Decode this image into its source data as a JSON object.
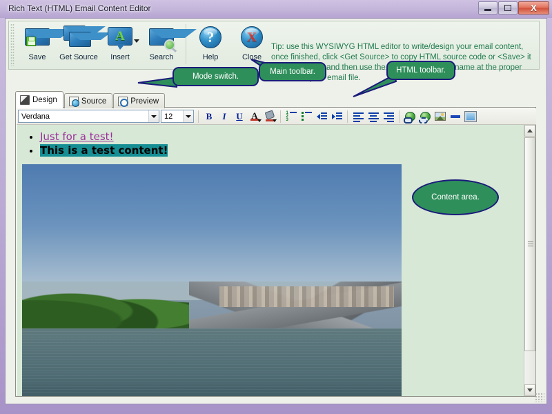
{
  "window": {
    "title": "Rich Text (HTML) Email Content Editor",
    "minimize_label": "Minimize",
    "maximize_label": "Maximize",
    "close_label": "X"
  },
  "main_toolbar": {
    "buttons": [
      {
        "label": "Save",
        "icon": "envelope-floppy-icon"
      },
      {
        "label": "Get Source",
        "icon": "two-envelopes-icon"
      },
      {
        "label": "Insert",
        "icon": "insert-text-bubble-icon",
        "has_dropdown": true
      },
      {
        "label": "Search",
        "icon": "envelope-magnifier-icon"
      },
      {
        "label": "Help",
        "icon": "blue-question-orb-icon"
      },
      {
        "label": "Close",
        "icon": "blue-red-x-orb-icon"
      }
    ],
    "tip": "Tip: use this WYSIWYG HTML editor to write/design your email content, once finished, click <Get Source> to copy HTML source code or <Save> it as a HTML file, and then use the source code or file name at the proper location of your email file."
  },
  "mode_tabs": [
    {
      "label": "Design",
      "icon": "design-palette-icon",
      "active": true
    },
    {
      "label": "Source",
      "icon": "source-code-icon",
      "active": false
    },
    {
      "label": "Preview",
      "icon": "preview-page-icon",
      "active": false
    }
  ],
  "html_toolbar": {
    "font_family": "Verdana",
    "font_size": "12",
    "buttons": [
      {
        "name": "bold",
        "label": "B"
      },
      {
        "name": "italic",
        "label": "I"
      },
      {
        "name": "underline",
        "label": "U"
      },
      {
        "name": "font-color",
        "label": "A"
      },
      {
        "name": "highlight-color",
        "label": ""
      },
      {
        "name": "numbered-list",
        "label": ""
      },
      {
        "name": "bulleted-list",
        "label": ""
      },
      {
        "name": "decrease-indent",
        "label": ""
      },
      {
        "name": "increase-indent",
        "label": ""
      },
      {
        "name": "align-left",
        "label": ""
      },
      {
        "name": "align-center",
        "label": ""
      },
      {
        "name": "align-right",
        "label": ""
      },
      {
        "name": "insert-link",
        "label": ""
      },
      {
        "name": "remove-link",
        "label": ""
      },
      {
        "name": "insert-image",
        "label": ""
      },
      {
        "name": "horizontal-rule",
        "label": ""
      },
      {
        "name": "insert-table",
        "label": ""
      }
    ]
  },
  "content": {
    "bullets": [
      {
        "text": "Just for a test!",
        "style": "link"
      },
      {
        "text": "This is a test content!",
        "style": "bold-highlight"
      }
    ],
    "image_alt": "Lake with limestone karst rocks, trees and village"
  },
  "callouts": [
    {
      "id": "mode-switch",
      "text": "Mode switch."
    },
    {
      "id": "main-toolbar",
      "text": "Main toolbar."
    },
    {
      "id": "html-toolbar",
      "text": "HTML toolbar."
    },
    {
      "id": "content-area",
      "text": "Content area."
    }
  ],
  "colors": {
    "callout_fill": "#2f8f5b",
    "callout_border": "#1b1b7a",
    "tip_text": "#1f7a4d",
    "canvas_bg": "#d7e8d6",
    "link_text": "#9c2f9c",
    "highlight": "#168f94",
    "titlebar": "#c3b4da"
  }
}
